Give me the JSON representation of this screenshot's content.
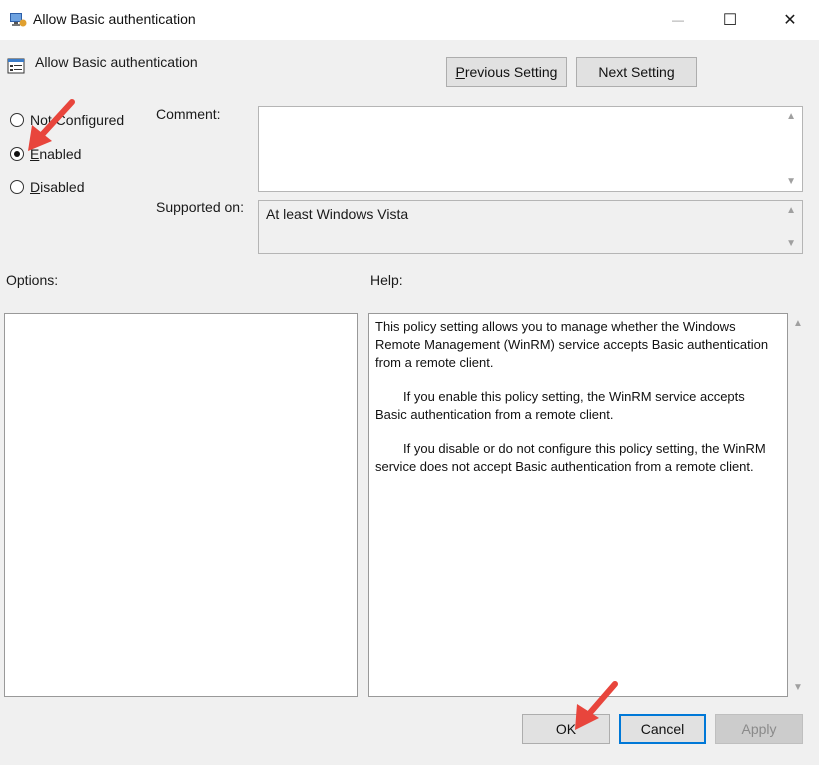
{
  "window": {
    "title": "Allow Basic authentication",
    "minimize_glyph": "—",
    "maximize_glyph": "☐",
    "close_glyph": "✕"
  },
  "header": {
    "policy_name": "Allow Basic authentication",
    "previous_button_pre": "",
    "previous_button_accel": "P",
    "previous_button_post": "revious Setting",
    "next_button": "Next Setting"
  },
  "state_options": [
    {
      "pre": "No",
      "accel": "t",
      "post": " Configured",
      "selected": false
    },
    {
      "pre": "",
      "accel": "E",
      "post": "nabled",
      "selected": true
    },
    {
      "pre": "",
      "accel": "D",
      "post": "isabled",
      "selected": false
    }
  ],
  "comment": {
    "label": "Comment:",
    "value": ""
  },
  "supported_on": {
    "label": "Supported on:",
    "value": "At least Windows Vista"
  },
  "options_label": "Options:",
  "help": {
    "label": "Help:",
    "paragraphs": [
      "This policy setting allows you to manage whether the Windows Remote Management (WinRM) service accepts Basic authentication from a remote client.",
      "If you enable this policy setting, the WinRM service accepts Basic authentication from a remote client.",
      "If you disable or do not configure this policy setting, the WinRM service does not accept Basic authentication from a remote client."
    ]
  },
  "footer": {
    "ok": "OK",
    "cancel": "Cancel",
    "apply": "Apply"
  },
  "colors": {
    "annotation_arrow": "#e8453c",
    "dialog_bg": "#f0f0f0",
    "focus_border": "#0078d7"
  }
}
